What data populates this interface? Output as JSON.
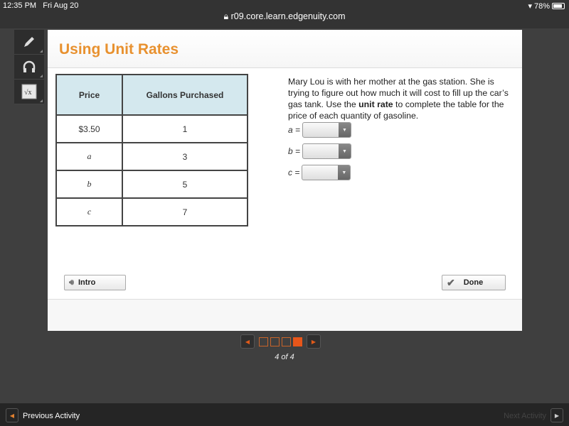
{
  "status": {
    "time": "12:35 PM",
    "date": "Fri Aug 20",
    "battery": "78%",
    "url": "r09.core.learn.edgenuity.com"
  },
  "tools": [
    {
      "name": "pencil-icon",
      "glyph": "✎"
    },
    {
      "name": "headphones-icon",
      "glyph": "🎧"
    },
    {
      "name": "calculator-icon",
      "glyph": "√x"
    }
  ],
  "title": "Using Unit Rates",
  "table": {
    "headers": [
      "Price",
      "Gallons Purchased"
    ],
    "rows": [
      {
        "price": "$3.50",
        "gallons": "1"
      },
      {
        "price": "a",
        "gallons": "3"
      },
      {
        "price": "b",
        "gallons": "5"
      },
      {
        "price": "c",
        "gallons": "7"
      }
    ]
  },
  "question": {
    "before": "Mary Lou is with her mother at the gas station. She is trying to figure out how much it will cost to fill up the car’s gas tank. Use the ",
    "bold": "unit rate",
    "after": " to complete the table for the price of each quantity of gasoline."
  },
  "answers": [
    {
      "label": "a =",
      "value": ""
    },
    {
      "label": "b =",
      "value": ""
    },
    {
      "label": "c =",
      "value": ""
    }
  ],
  "buttons": {
    "intro": "Intro",
    "done": "Done"
  },
  "pager": {
    "current": 4,
    "total": 4,
    "label": "4 of 4"
  },
  "nav": {
    "previous": "Previous Activity",
    "next": "Next Activity"
  }
}
